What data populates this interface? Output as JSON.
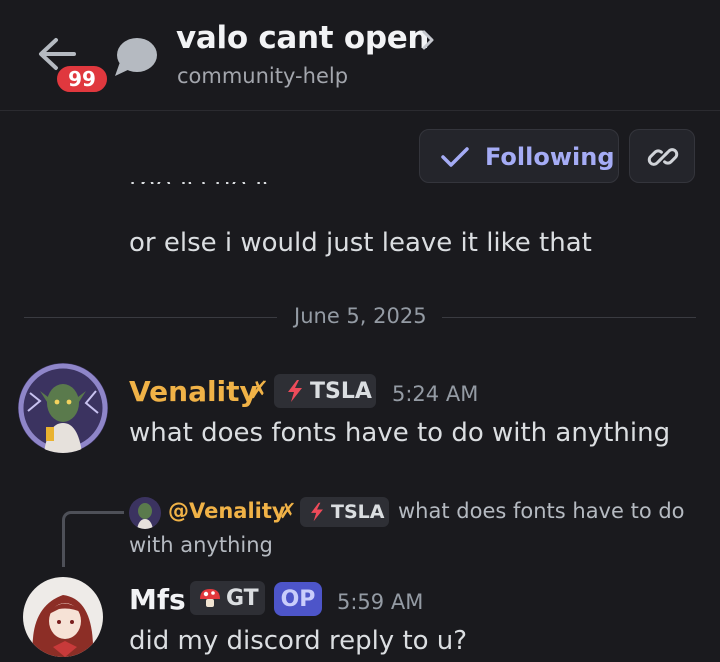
{
  "header": {
    "title": "valo cant open",
    "subtitle": "community-help",
    "unread_count": "99"
  },
  "actions": {
    "follow_label": "Following"
  },
  "messages": {
    "prev_partial_line": "the issue is",
    "prev_line": "or else i would just leave it like that",
    "date_divider": "June 5, 2025",
    "venality": {
      "username": "Venality",
      "name_mark": "✗",
      "tag": "TSLA",
      "timestamp": "5:24 AM",
      "text": "what does fonts have to do with anything",
      "name_color": "#f0b247"
    },
    "reply": {
      "mention": "@Venality",
      "name_mark": "✗",
      "tag": "TSLA",
      "text_line1": "what does fonts have to do",
      "text_line2": "with anything"
    },
    "mfs": {
      "username": "Mfs",
      "tag": "GT",
      "op_label": "OP",
      "timestamp": "5:59 AM",
      "text": "did my discord reply to u?"
    }
  },
  "colors": {
    "background": "#1a1a1e",
    "accent": "#a5acf5",
    "badge": "#e0383e",
    "op": "#4d55c9"
  },
  "icons": [
    "back-arrow-icon",
    "thread-bubble-icon",
    "chevron-right-icon",
    "check-icon",
    "link-icon",
    "lightning-icon",
    "mushroom-icon"
  ]
}
